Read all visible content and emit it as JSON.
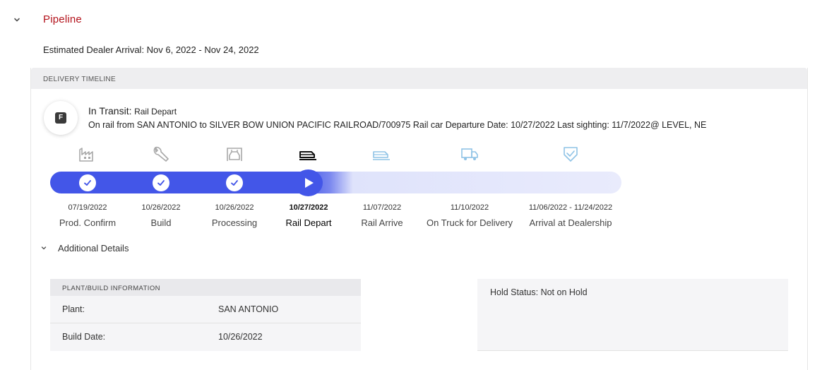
{
  "pipeline": {
    "title": "Pipeline",
    "eta_text": "Estimated Dealer Arrival: Nov 6, 2022 - Nov 24, 2022"
  },
  "timeline": {
    "header_label": "DELIVERY TIMELINE",
    "badge_letter": "F",
    "status_label": "In Transit:",
    "status_value": "Rail Depart",
    "status_detail": "On rail from SAN ANTONIO to SILVER BOW UNION PACIFIC RAILROAD/700975 Rail car Departure Date: 10/27/2022 Last sighting: 11/7/2022@ LEVEL, NE",
    "progress_stage_index": 3,
    "stages": [
      {
        "date": "07/19/2022",
        "name": "Prod. Confirm",
        "icon": "factory-icon",
        "state": "complete"
      },
      {
        "date": "10/26/2022",
        "name": "Build",
        "icon": "wrench-icon",
        "state": "complete"
      },
      {
        "date": "10/26/2022",
        "name": "Processing",
        "icon": "car-wash-icon",
        "state": "complete"
      },
      {
        "date": "10/27/2022",
        "name": "Rail Depart",
        "icon": "train-icon",
        "state": "current"
      },
      {
        "date": "11/07/2022",
        "name": "Rail Arrive",
        "icon": "train-arrive-icon",
        "state": "upcoming"
      },
      {
        "date": "11/10/2022",
        "name": "On Truck for Delivery",
        "icon": "truck-icon",
        "state": "upcoming"
      },
      {
        "date": "11/06/2022 - 11/24/2022",
        "name": "Arrival at Dealership",
        "icon": "shield-check-icon",
        "state": "upcoming"
      }
    ],
    "colors": {
      "accent": "#4356e8",
      "brand_red": "#b3121b",
      "upcoming_icon": "#8fc3e6",
      "complete_icon": "#a8a8a8"
    }
  },
  "additional_details": {
    "label": "Additional Details",
    "plant_header": "PLANT/BUILD INFORMATION",
    "rows": [
      {
        "key": "Plant:",
        "value": "SAN ANTONIO"
      },
      {
        "key": "Build Date:",
        "value": "10/26/2022"
      }
    ],
    "hold_status": "Hold Status: Not on Hold"
  }
}
